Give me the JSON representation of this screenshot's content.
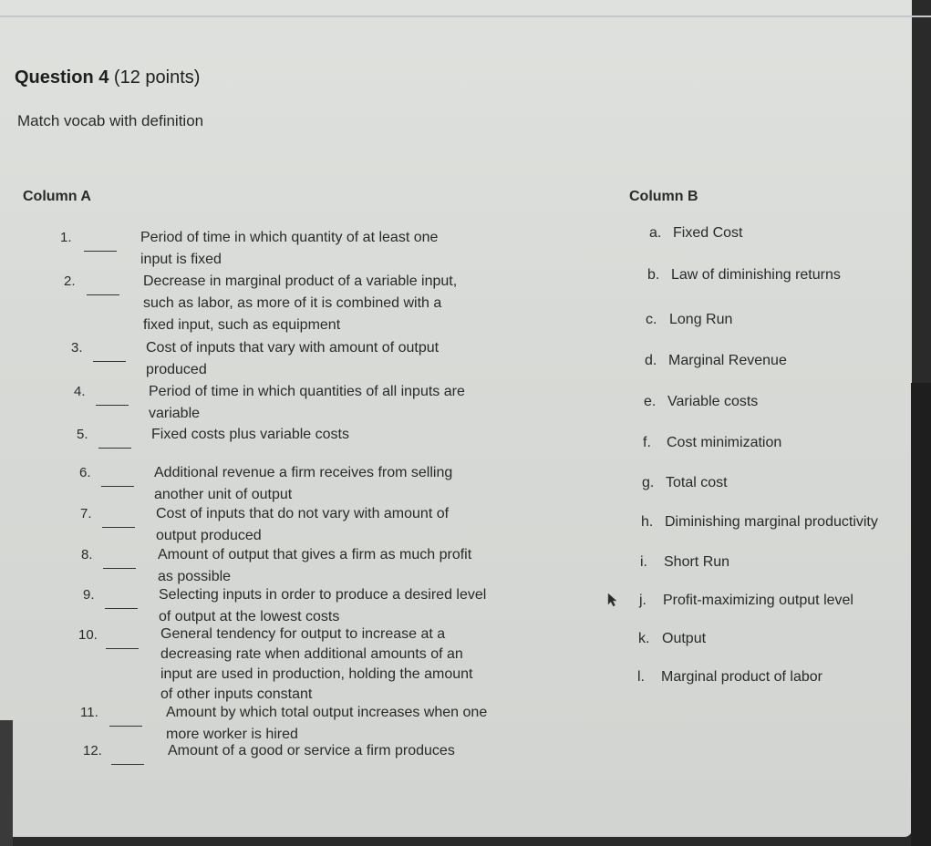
{
  "question": {
    "title": "Question 4",
    "points": "(12 points)",
    "instructions": "Match vocab with definition"
  },
  "column_a": {
    "header": "Column A",
    "items": [
      {
        "number": "1.",
        "answer": "",
        "lines": [
          "Period of time in which quantity of at least one",
          "input is fixed"
        ]
      },
      {
        "number": "2.",
        "answer": "",
        "lines": [
          "Decrease in marginal product of a variable input,",
          "such as labor, as more of it is combined with a",
          "fixed input, such as equipment"
        ]
      },
      {
        "number": "3.",
        "answer": "",
        "lines": [
          "Cost of inputs that vary with amount of output",
          "produced"
        ]
      },
      {
        "number": "4.",
        "answer": "",
        "lines": [
          "Period of time in which quantities of all inputs are",
          "variable"
        ]
      },
      {
        "number": "5.",
        "answer": "",
        "lines": [
          "Fixed costs plus variable costs"
        ]
      },
      {
        "number": "6.",
        "answer": "",
        "lines": [
          "Additional revenue a firm receives from selling",
          "another unit of output"
        ]
      },
      {
        "number": "7.",
        "answer": "",
        "lines": [
          "Cost of inputs that do not vary with amount of",
          "output produced"
        ]
      },
      {
        "number": "8.",
        "answer": "",
        "lines": [
          "Amount of output that gives a firm as much profit",
          "as possible"
        ]
      },
      {
        "number": "9.",
        "answer": "",
        "lines": [
          "Selecting inputs in order to produce a desired level",
          "of output at the lowest costs"
        ]
      },
      {
        "number": "10.",
        "answer": "",
        "lines": [
          "General tendency for output to increase at a",
          "decreasing rate when additional amounts of an",
          "input are used in production, holding the amount",
          "of other inputs constant"
        ]
      },
      {
        "number": "11.",
        "answer": "",
        "lines": [
          "Amount by which total output increases when one",
          "more worker is hired"
        ]
      },
      {
        "number": "12.",
        "answer": "",
        "lines": [
          "Amount of a good or service a firm produces"
        ]
      }
    ]
  },
  "column_b": {
    "header": "Column B",
    "items": [
      {
        "letter": "a.",
        "term": "Fixed Cost"
      },
      {
        "letter": "b.",
        "term": "Law of diminishing returns"
      },
      {
        "letter": "c.",
        "term": "Long Run"
      },
      {
        "letter": "d.",
        "term": "Marginal Revenue"
      },
      {
        "letter": "e.",
        "term": "Variable costs"
      },
      {
        "letter": "f.",
        "term": "Cost minimization"
      },
      {
        "letter": "g.",
        "term": "Total cost"
      },
      {
        "letter": "h.",
        "term": "Diminishing marginal productivity"
      },
      {
        "letter": "i.",
        "term": "Short Run"
      },
      {
        "letter": "j.",
        "term": "Profit-maximizing output level"
      },
      {
        "letter": "k.",
        "term": "Output"
      },
      {
        "letter": "l.",
        "term": "Marginal product of labor"
      }
    ]
  }
}
